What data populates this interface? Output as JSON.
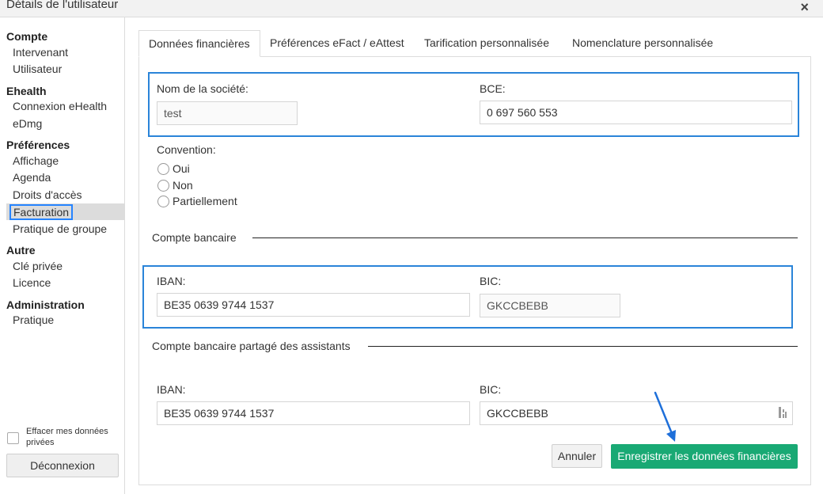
{
  "window": {
    "title": "Détails de l'utilisateur",
    "close_icon": "×"
  },
  "sidebar": {
    "groups": [
      {
        "heading": "Compte",
        "items": [
          "Intervenant",
          "Utilisateur"
        ]
      },
      {
        "heading": "Ehealth",
        "items": [
          "Connexion eHealth",
          "eDmg"
        ]
      },
      {
        "heading": "Préférences",
        "items": [
          "Affichage",
          "Agenda",
          "Droits d'accès",
          "Facturation",
          "Pratique de groupe"
        ]
      },
      {
        "heading": "Autre",
        "items": [
          "Clé privée",
          "Licence"
        ]
      },
      {
        "heading": "Administration",
        "items": [
          "Pratique"
        ]
      }
    ],
    "active_item": "Facturation",
    "erase_label": "Effacer mes données privées",
    "logout_label": "Déconnexion"
  },
  "tabs": [
    {
      "label": "Données financières",
      "active": true
    },
    {
      "label": "Préférences eFact / eAttest",
      "active": false
    },
    {
      "label": "Tarification personnalisée",
      "active": false
    },
    {
      "label": "Nomenclature personnalisée",
      "active": false
    }
  ],
  "form": {
    "company_label": "Nom de la société:",
    "company_value": "test",
    "bce_label": "BCE:",
    "bce_value": "0 697 560 553",
    "convention_label": "Convention:",
    "convention_options": [
      "Oui",
      "Non",
      "Partiellement"
    ],
    "bank": {
      "section_title": "Compte bancaire",
      "iban_label": "IBAN:",
      "iban_value": "BE35 0639 9744 1537",
      "bic_label": "BIC:",
      "bic_value": "GKCCBEBB"
    },
    "shared_bank": {
      "section_title": "Compte bancaire partagé des assistants",
      "iban_label": "IBAN:",
      "iban_value": "BE35 0639 9744 1537",
      "bic_label": "BIC:",
      "bic_value": "GKCCBEBB"
    }
  },
  "actions": {
    "cancel_label": "Annuler",
    "save_label": "Enregistrer les données financières"
  },
  "colors": {
    "accent_blue": "#2a84d9",
    "save_green": "#19a974",
    "arrow_blue": "#1e6fd9"
  }
}
